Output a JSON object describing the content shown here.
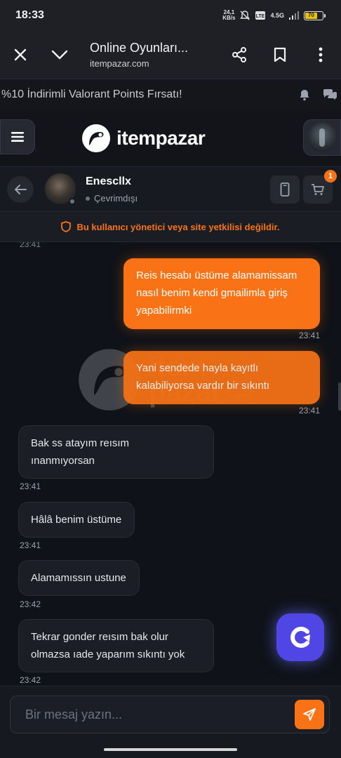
{
  "status_bar": {
    "time": "18:33",
    "net_speed_value": "24,1",
    "net_speed_unit": "KB/s",
    "network": "4.5G",
    "battery": "70"
  },
  "browser": {
    "title": "Online Oyunları...",
    "url": "itempazar.com"
  },
  "promo": {
    "text": "%10 İndirimli Valorant Points Fırsatı!"
  },
  "site": {
    "logo_text": "itempazar"
  },
  "chat_header": {
    "user_name": "Enescllx",
    "user_status": "Çevrimdışı",
    "cart_count": "1"
  },
  "warning": {
    "text": "Bu kullanıcı yönetici veya site yetkilisi değildir."
  },
  "messages": {
    "top_time": "23:41",
    "items": [
      {
        "direction": "out",
        "lines": [
          "Reis hesabı üstüme alamamissam",
          "nasıl benim kendi gmailimla giriş",
          "yapabilirmki"
        ],
        "time": "23:41"
      },
      {
        "direction": "out",
        "lines": [
          "Yani sendede hayla kayıtlı",
          "kalabiliyorsa vardır bir sıkıntı"
        ],
        "time": "23:41"
      },
      {
        "direction": "in",
        "lines": [
          "Bak ss atayım reısım",
          "ınanmıyorsan"
        ],
        "time": "23:41"
      },
      {
        "direction": "in",
        "lines": [
          "Hâlâ benim üstüme"
        ],
        "time": "23:41"
      },
      {
        "direction": "in",
        "lines": [
          "Alamamıssın ustune"
        ],
        "time": "23:42"
      },
      {
        "direction": "in",
        "lines": [
          "Tekrar gonder reısım bak olur",
          "olmazsa ıade yaparım sıkıntı yok"
        ],
        "time": "23:42"
      }
    ]
  },
  "watermark": {
    "line1": "item",
    "line2": "pazar",
    "suffix": ".com"
  },
  "composer": {
    "placeholder": "Bir mesaj yazın..."
  },
  "colors": {
    "accent": "#f97316",
    "fab": "#4f46e5",
    "background": "#0f1218"
  },
  "icons": {
    "close": "close-icon",
    "collapse": "chevron-down-icon",
    "share": "share-icon",
    "bookmark": "bookmark-icon",
    "more": "more-vertical-icon",
    "notification": "bell-icon",
    "chat": "chat-bubbles-icon",
    "menu": "hamburger-icon",
    "back": "arrow-left-icon",
    "phone": "mobile-phone-icon",
    "cart": "cart-icon",
    "shield": "shield-icon",
    "send": "send-icon",
    "support": "support-widget-icon"
  }
}
